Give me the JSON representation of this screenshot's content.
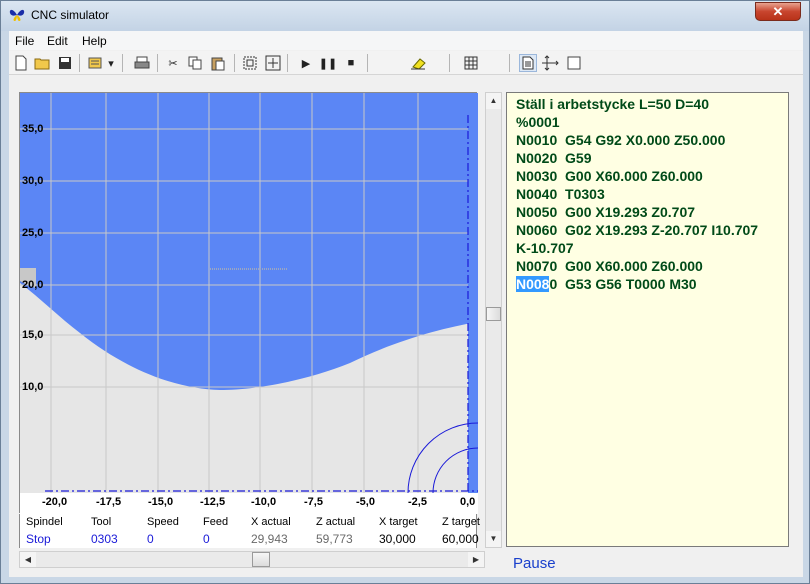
{
  "window": {
    "title": "CNC simulator",
    "close": "✕"
  },
  "menu": [
    "File",
    "Edit",
    "Help"
  ],
  "toolbar": [
    "new-file",
    "open-folder",
    "save",
    "settings-dropdown",
    "print",
    "cut",
    "copy",
    "paste",
    "zoom-fit",
    "zoom-extents",
    "play",
    "pause",
    "stop",
    "eraser",
    "grid",
    "document",
    "move-axes",
    "blank-square"
  ],
  "plot": {
    "x_ticks": [
      "-20,0",
      "-17,5",
      "-15,0",
      "-12,5",
      "-10,0",
      "-7,5",
      "-5,0",
      "-2,5",
      "0,0"
    ],
    "y_ticks": [
      "35,0",
      "30,0",
      "25,0",
      "20,0",
      "15,0",
      "10,0"
    ],
    "colors": {
      "stock": "#5b86f5",
      "part": "#e6e6e6",
      "tool": "#1a1ad8"
    }
  },
  "status": {
    "headers": [
      "Spindel",
      "Tool",
      "Speed",
      "Feed",
      "X actual",
      "Z actual",
      "X target",
      "Z target"
    ],
    "values": [
      "Stop",
      "0303",
      "0",
      "0",
      "29,943",
      "59,773",
      "30,000",
      "60,000"
    ]
  },
  "program": {
    "lines": [
      "Ställ i arbetstycke L=50 D=40",
      "%0001",
      "N0010  G54 G92 X0.000 Z50.000",
      "N0020  G59",
      "N0030  G00 X60.000 Z60.000",
      "N0040  T0303",
      "N0050  G00 X19.293 Z0.707",
      "N0060  G02 X19.293 Z-20.707 I10.707",
      "K-10.707",
      "N0070  G00 X60.000 Z60.000"
    ],
    "current_sel": "N008",
    "current_rest": "0  G53 G56 T0000 M30"
  },
  "state": "Pause"
}
